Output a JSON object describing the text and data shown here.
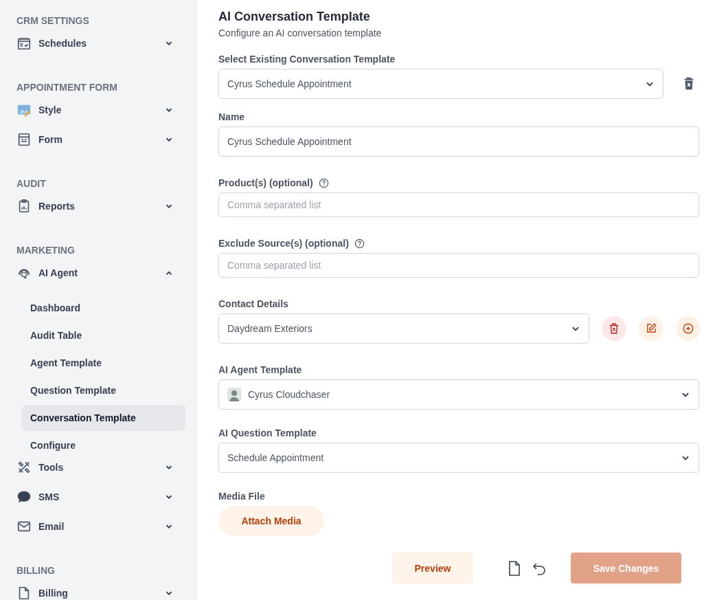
{
  "sidebar": {
    "sections": [
      {
        "heading": "CRM SETTINGS",
        "items": [
          {
            "kind": "calendar",
            "label": "Schedules",
            "expanded": false
          }
        ]
      },
      {
        "heading": "APPOINTMENT FORM",
        "items": [
          {
            "kind": "image",
            "label": "Style",
            "expanded": false
          },
          {
            "kind": "form",
            "label": "Form",
            "expanded": false
          }
        ]
      },
      {
        "heading": "AUDIT",
        "items": [
          {
            "kind": "clipboard",
            "label": "Reports",
            "expanded": false
          }
        ]
      },
      {
        "heading": "MARKETING",
        "items": [
          {
            "kind": "headset",
            "label": "AI Agent",
            "expanded": true,
            "children": [
              {
                "label": "Dashboard",
                "selected": false
              },
              {
                "label": "Audit Table",
                "selected": false
              },
              {
                "label": "Agent Template",
                "selected": false
              },
              {
                "label": "Question Template",
                "selected": false
              },
              {
                "label": "Conversation Template",
                "selected": true
              },
              {
                "label": "Configure",
                "selected": false
              }
            ]
          },
          {
            "kind": "tools",
            "label": "Tools",
            "expanded": false
          },
          {
            "kind": "sms",
            "label": "SMS",
            "expanded": false
          },
          {
            "kind": "mail",
            "label": "Email",
            "expanded": false
          }
        ]
      },
      {
        "heading": "BILLING",
        "items": [
          {
            "kind": "document",
            "label": "Billing",
            "expanded": false
          }
        ]
      }
    ]
  },
  "page": {
    "title": "AI Conversation Template",
    "subtitle": "Configure an AI conversation template"
  },
  "fields": [
    {
      "kind": "select",
      "label": "Select Existing Conversation Template",
      "value": "Cyrus Schedule Appointment",
      "actions": [
        {
          "kind": "delete"
        }
      ]
    },
    {
      "kind": "text",
      "label": "Name",
      "value": "Cyrus Schedule Appointment"
    },
    {
      "kind": "text",
      "label": "Product(s) (optional)",
      "help": true,
      "placeholder": "Comma separated list"
    },
    {
      "kind": "text",
      "label": "Exclude Source(s) (optional)",
      "help": true,
      "placeholder": "Comma separated list"
    },
    {
      "kind": "select",
      "label": "Contact Details",
      "value": "Daydream Exteriors",
      "actions": [
        {
          "kind": "delete-round"
        },
        {
          "kind": "edit"
        },
        {
          "kind": "add"
        }
      ]
    },
    {
      "kind": "select",
      "label": "AI Agent Template",
      "value": "Cyrus Cloudchaser",
      "avatar": true
    },
    {
      "kind": "select",
      "label": "AI Question Template",
      "value": "Schedule Appointment"
    },
    {
      "kind": "media",
      "label": "Media File",
      "button": "Attach Media"
    }
  ],
  "footer": {
    "preview": "Preview",
    "save": {
      "label": "Save Changes",
      "disabled": true
    }
  }
}
